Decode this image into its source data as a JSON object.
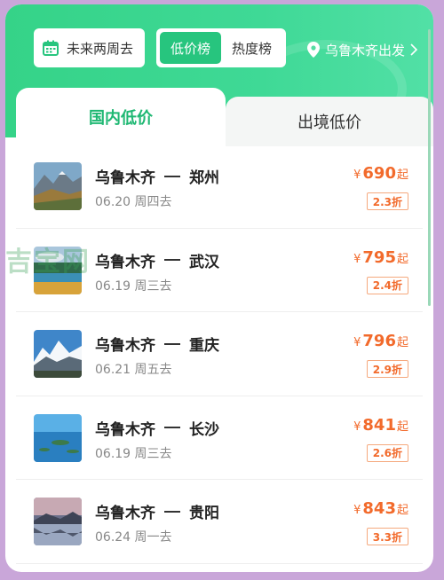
{
  "header": {
    "date_filter_label": "未来两周去",
    "rank_tabs": [
      {
        "label": "低价榜",
        "active": true
      },
      {
        "label": "热度榜",
        "active": false
      }
    ],
    "departure_label": "乌鲁木齐出发",
    "accent_color": "#27c57e"
  },
  "main_tabs": [
    {
      "label": "国内低价",
      "active": true
    },
    {
      "label": "出境低价",
      "active": false
    }
  ],
  "watermark": "吉宝网",
  "flights": [
    {
      "from": "乌鲁木齐",
      "to": "郑州",
      "date": "06.20 周四去",
      "currency": "¥",
      "price": "690",
      "suffix": "起",
      "discount": "2.3折",
      "image": "mountain-valley"
    },
    {
      "from": "乌鲁木齐",
      "to": "武汉",
      "date": "06.19 周三去",
      "currency": "¥",
      "price": "795",
      "suffix": "起",
      "discount": "2.4折",
      "image": "lake-forest"
    },
    {
      "from": "乌鲁木齐",
      "to": "重庆",
      "date": "06.21 周五去",
      "currency": "¥",
      "price": "796",
      "suffix": "起",
      "discount": "2.9折",
      "image": "snow-mountain"
    },
    {
      "from": "乌鲁木齐",
      "to": "长沙",
      "date": "06.19 周三去",
      "currency": "¥",
      "price": "841",
      "suffix": "起",
      "discount": "2.6折",
      "image": "blue-lake"
    },
    {
      "from": "乌鲁木齐",
      "to": "贵阳",
      "date": "06.24 周一去",
      "currency": "¥",
      "price": "843",
      "suffix": "起",
      "discount": "3.3折",
      "image": "mountain-reflection"
    }
  ]
}
